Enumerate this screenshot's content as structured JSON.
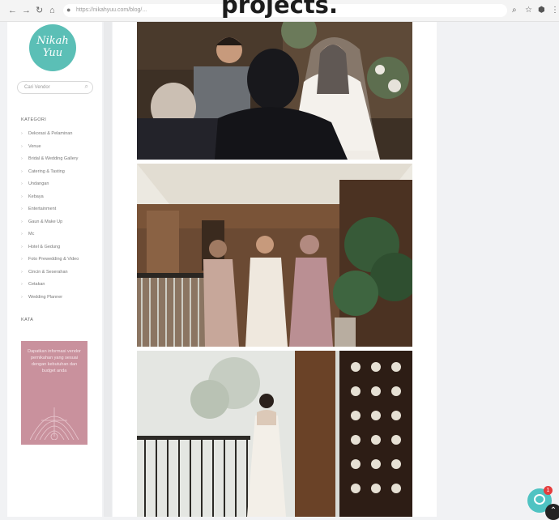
{
  "overlay": {
    "title": "projects."
  },
  "browser": {
    "url": "https://nikahyuu.com/blog/...",
    "nav": {
      "back": "←",
      "forward": "→",
      "reload": "↻",
      "home": "⌂"
    },
    "lock_icon": "lock-icon",
    "extensions": [
      "⌕",
      "☆",
      "⬢",
      "⋮"
    ]
  },
  "sidebar": {
    "logo_text": "Nikah\nYuu",
    "logo_color": "#5bbfb6",
    "search_placeholder": "Cari Vendor",
    "categories_heading": "KATEGORI",
    "categories": [
      "Dekorasi & Pelaminan",
      "Venue",
      "Bridal & Wedding Gallery",
      "Catering & Tasting",
      "Undangan",
      "Kebaya",
      "Entertainment",
      "Gaun & Make Up",
      "Mc",
      "Hotel & Gedung",
      "Foto Prewedding & Video",
      "Cincin & Seserahan",
      "Cetakan",
      "Wedding Planner"
    ],
    "section2_heading": "KATA",
    "banner": {
      "text": "Dapatkan informasi vendor pernikahan yang sesuai dengan kebutuhan dan budget anda",
      "color": "#c9919d"
    }
  },
  "widgets": {
    "chat_badge": "1",
    "up_arrow": "⌃"
  }
}
